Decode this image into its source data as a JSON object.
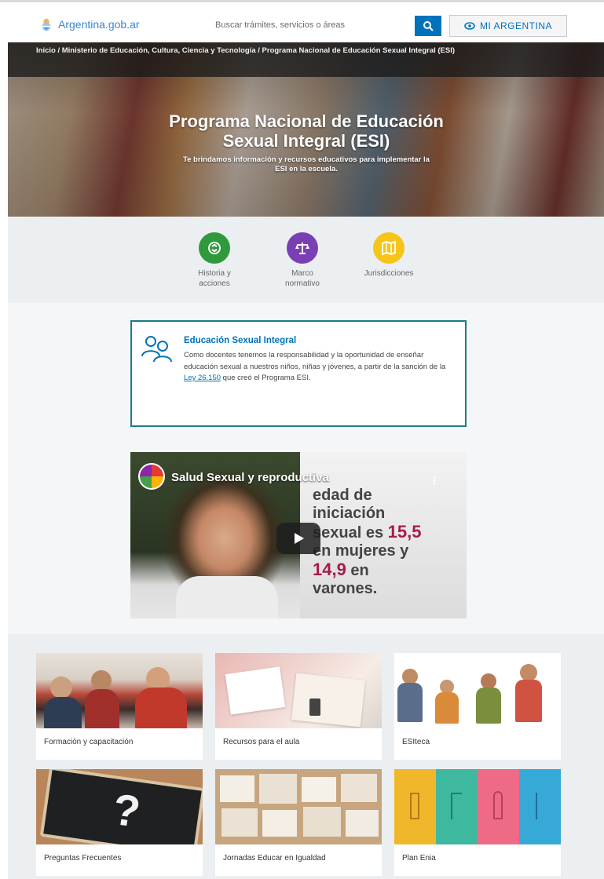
{
  "header": {
    "brand": "Argentina.gob.ar",
    "search_placeholder": "Buscar trámites, servicios o áreas",
    "mi_argentina": "MI ARGENTINA"
  },
  "breadcrumb": {
    "items": [
      "Inicio",
      "Ministerio de Educación, Cultura, Ciencia y Tecnología",
      "Programa Nacional de Educación Sexual Integral (ESI)"
    ],
    "separator": " / "
  },
  "hero": {
    "title_line1": "Programa Nacional de Educación",
    "title_line2": "Sexual Integral (ESI)",
    "subtitle_line1": "Te brindamos información y recursos educativos para implementar la",
    "subtitle_line2": "ESI en la escuela."
  },
  "quick_links": [
    {
      "label_line1": "Historia y",
      "label_line2": "acciones",
      "color": "#2e9a3c",
      "icon": "history-icon"
    },
    {
      "label_line1": "Marco",
      "label_line2": "normativo",
      "color": "#7b3fb4",
      "icon": "scale-icon"
    },
    {
      "label_line1": "Jurisdicciones",
      "label_line2": "",
      "color": "#f5c518",
      "icon": "map-icon"
    }
  ],
  "esi_card": {
    "title": "Educación Sexual Integral",
    "body_before_link": "Como docentes tenemos la responsabilidad y la oportunidad de enseñar educación sexual a nuestros niños, niñas y jóvenes, a partir de la sanción de la ",
    "link": "Ley 26.150",
    "body_after_link": " que creó el Programa ESI."
  },
  "video": {
    "title": "Salud Sexual y reproductiva",
    "text_line1": "edad de",
    "text_line2": "iniciación",
    "text_line3_prefix": "sexual es ",
    "highlight1": "15,5",
    "text_line4": "en mujeres y",
    "highlight2": "14,9",
    "text_line5_suffix": " en",
    "text_line6": "varones.",
    "more": "⋮"
  },
  "tiles": [
    {
      "label": "Formación y capacitación"
    },
    {
      "label": "Recursos para el aula"
    },
    {
      "label": "ESIteca"
    },
    {
      "label": "Preguntas Frecuentes"
    },
    {
      "label": "Jornadas Educar en Igualdad"
    },
    {
      "label": "Plan Enia"
    }
  ],
  "colors": {
    "accent": "#0072bb",
    "card_border": "#1e7d86",
    "highlight": "#a51c48"
  }
}
